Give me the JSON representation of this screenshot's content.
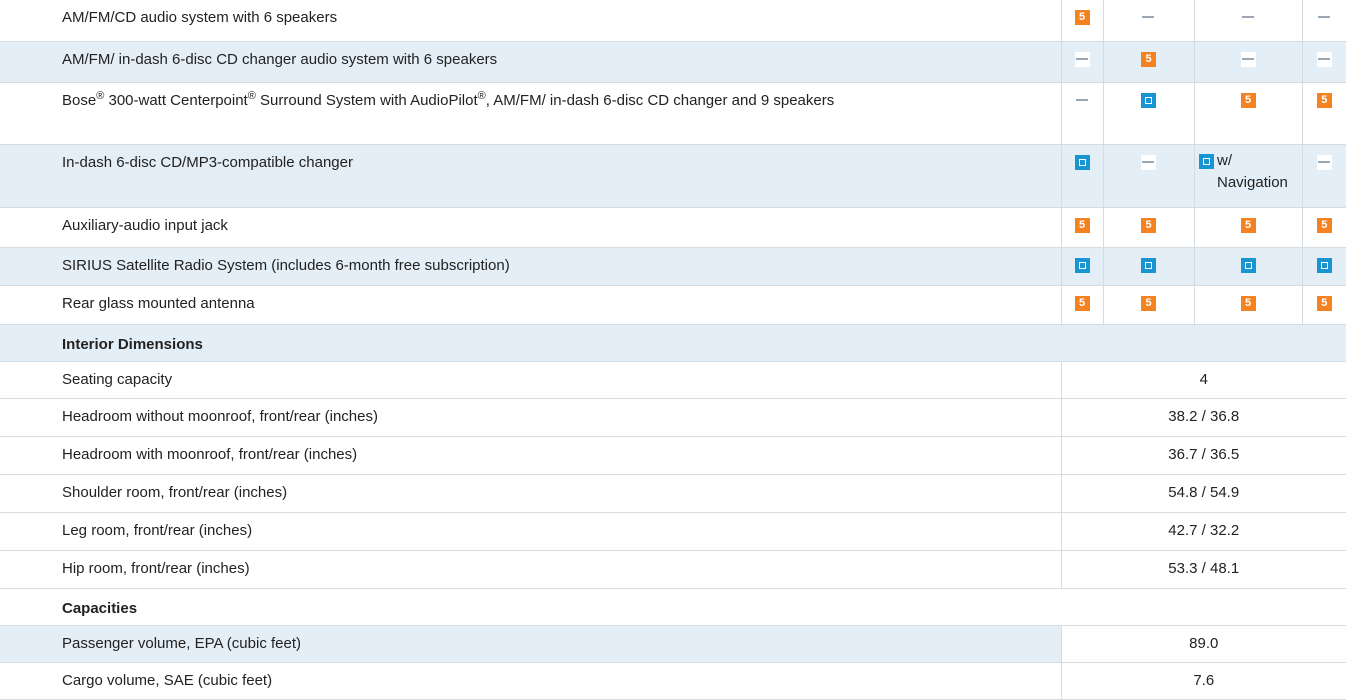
{
  "audio_rows": [
    {
      "label": "AM/FM/CD audio system with 6 speakers",
      "marks": [
        "standard-icon",
        "not-available-icon",
        "not-available-icon",
        "not-available-icon"
      ]
    },
    {
      "label": "AM/FM/ in-dash 6-disc CD changer audio system with 6 speakers",
      "marks": [
        "not-available-icon",
        "standard-icon",
        "not-available-icon",
        "not-available-icon"
      ]
    },
    {
      "label_parts": [
        "Bose",
        "®",
        " 300-watt Centerpoint",
        "®",
        " Surround System with AudioPilot",
        "®",
        ", AM/FM/ in-dash 6-disc CD changer and 9 speakers"
      ],
      "marks": [
        "not-available-icon",
        "optional-icon",
        "standard-icon",
        "standard-icon"
      ]
    },
    {
      "label": "In-dash 6-disc CD/MP3-compatible changer",
      "marks": [
        "optional-icon",
        "not-available-icon",
        "optional-icon",
        "not-available-icon"
      ],
      "note": "w/ Navigation"
    },
    {
      "label": "Auxiliary-audio input jack",
      "marks": [
        "standard-icon",
        "standard-icon",
        "standard-icon",
        "standard-icon"
      ]
    },
    {
      "label": "SIRIUS Satellite Radio System (includes 6-month free subscription)",
      "marks": [
        "optional-icon",
        "optional-icon",
        "optional-icon",
        "optional-icon"
      ]
    },
    {
      "label": "Rear glass mounted antenna",
      "marks": [
        "standard-icon",
        "standard-icon",
        "standard-icon",
        "standard-icon"
      ]
    }
  ],
  "sections": {
    "interior": "Interior Dimensions",
    "capacities": "Capacities"
  },
  "interior_rows": [
    {
      "label": "Seating capacity",
      "value": "4"
    },
    {
      "label": "Headroom without moonroof, front/rear (inches)",
      "value": "38.2 / 36.8"
    },
    {
      "label": "Headroom with moonroof, front/rear (inches)",
      "value": "36.7 / 36.5"
    },
    {
      "label": "Shoulder room, front/rear (inches)",
      "value": "54.8 / 54.9"
    },
    {
      "label": "Leg room, front/rear (inches)",
      "value": "42.7 / 32.2"
    },
    {
      "label": "Hip room, front/rear (inches)",
      "value": "53.3 / 48.1"
    }
  ],
  "capacity_rows": [
    {
      "label": "Passenger volume, EPA (cubic feet)",
      "value": "89.0"
    },
    {
      "label": "Cargo volume, SAE (cubic feet)",
      "value": "7.6"
    }
  ],
  "colors": {
    "standard": "#f58220",
    "optional": "#1996d1",
    "row_alt": "#e3eef6"
  }
}
